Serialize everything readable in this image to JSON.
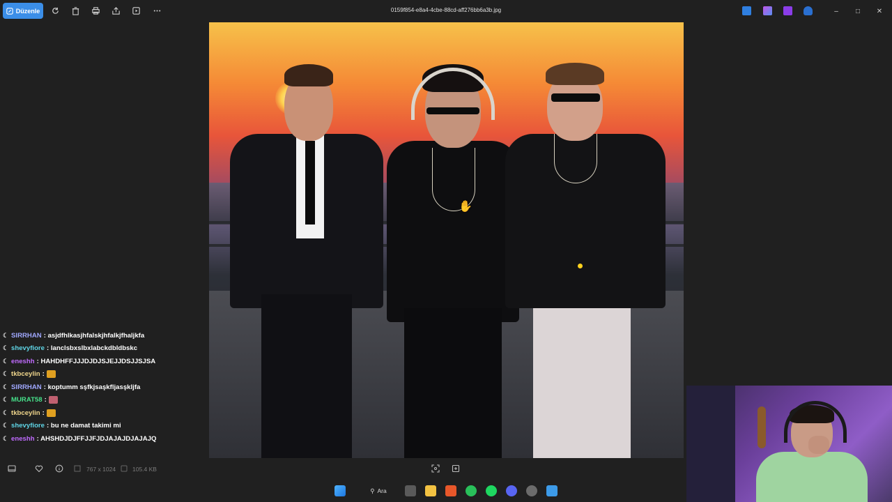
{
  "toolbar": {
    "edit_label": "Düzenle",
    "title": "0159f854-e8a4-4cbe-88cd-aff276bb6a3b.jpg"
  },
  "chat": [
    {
      "user": "SIRRHAN",
      "color": "#a0a8ff",
      "message": ": asjdfhlkasjhfalskjhfalkjfhaljkfa"
    },
    {
      "user": "shevyfiore",
      "color": "#5fd5e6",
      "message": ": lanclsbxslbxlabckdbldbskc"
    },
    {
      "user": "eneshh",
      "color": "#c06bff",
      "message": ": HAHDHFFJJJDJDJSJEJJDSJJSJSA"
    },
    {
      "user": "tkbceylin",
      "color": "#f0d68c",
      "message": ":",
      "emote": "#e0a020"
    },
    {
      "user": "SIRRHAN",
      "color": "#a0a8ff",
      "message": ": koptumm sşfkjsaşkfljasşkljfa"
    },
    {
      "user": "MURAT58",
      "color": "#46e08a",
      "message": ":",
      "emote": "#c06070"
    },
    {
      "user": "tkbceylin",
      "color": "#f0d68c",
      "message": ":",
      "emote": "#e0a020"
    },
    {
      "user": "shevyfiore",
      "color": "#5fd5e6",
      "message": ": bu ne damat takimi mi"
    },
    {
      "user": "eneshh",
      "color": "#c06bff",
      "message": ": AHSHDJDJFFJJFJDJAJAJDJAJAJQ"
    }
  ],
  "bottombar": {
    "dimensions": "767 x 1024",
    "file_size": "105.4 KB"
  },
  "taskbar": {
    "search_label": "Ara"
  },
  "colors": {
    "accent": "#3b8ee8",
    "background": "#202020"
  }
}
